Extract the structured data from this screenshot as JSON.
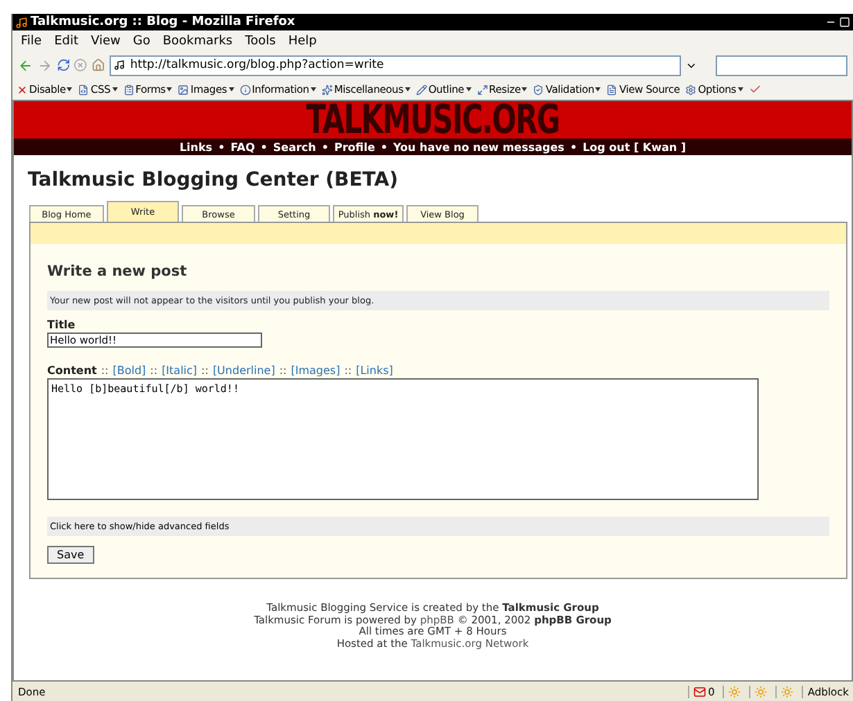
{
  "window": {
    "title": "Talkmusic.org :: Blog - Mozilla Firefox"
  },
  "menu": [
    "File",
    "Edit",
    "View",
    "Go",
    "Bookmarks",
    "Tools",
    "Help"
  ],
  "address": {
    "value": "http://talkmusic.org/blog.php?action=write"
  },
  "toolbar": [
    {
      "label": "Disable",
      "dropdown": true
    },
    {
      "label": "CSS",
      "dropdown": true
    },
    {
      "label": "Forms",
      "dropdown": true
    },
    {
      "label": "Images",
      "dropdown": true
    },
    {
      "label": "Information",
      "dropdown": true
    },
    {
      "label": "Miscellaneous",
      "dropdown": true
    },
    {
      "label": "Outline",
      "dropdown": true
    },
    {
      "label": "Resize",
      "dropdown": true
    },
    {
      "label": "Validation",
      "dropdown": true
    },
    {
      "label": "View Source",
      "dropdown": false
    },
    {
      "label": "Options",
      "dropdown": true
    }
  ],
  "site": {
    "logo": "TALKMUSIC.ORG",
    "separator": "•",
    "nav": [
      "Links",
      "FAQ",
      "Search",
      "Profile",
      "You have no new messages",
      "Log out [ Kwan ]"
    ]
  },
  "page_title": "Talkmusic Blogging Center (BETA)",
  "tabs": [
    {
      "label": "Blog Home",
      "selected": false
    },
    {
      "label": "Write",
      "selected": true
    },
    {
      "label": "Browse",
      "selected": false
    },
    {
      "label": "Setting",
      "selected": false
    },
    {
      "label": "Publish **now!**",
      "selected": false
    },
    {
      "label": "View Blog",
      "selected": false
    }
  ],
  "form": {
    "heading": "Write a new post",
    "notice": "Your new post will not appear to the visitors until you publish your blog.",
    "title_label": "Title",
    "title_value": "Hello world!!",
    "content_label": "Content",
    "separator": "::",
    "format_links": [
      "[Bold]",
      "[Italic]",
      "[Underline]",
      "[Images]",
      "[Links]"
    ],
    "content_value": "Hello [b]beautiful[/b] world!!",
    "advanced": "Click here to show/hide advanced fields",
    "save": "Save"
  },
  "footer": [
    [
      {
        "kind": "plain",
        "text": "Talkmusic Blogging Service is created by the "
      },
      {
        "kind": "bold",
        "text": "Talkmusic Group"
      }
    ],
    [
      {
        "kind": "plain",
        "text": "Talkmusic Forum is powered by "
      },
      {
        "kind": "link",
        "text": "phpBB"
      },
      {
        "kind": "plain",
        "text": " © 2001, 2002 "
      },
      {
        "kind": "bold",
        "text": "phpBB Group"
      }
    ],
    [
      {
        "kind": "plain",
        "text": "All times are GMT + 8 Hours"
      }
    ],
    [
      {
        "kind": "plain",
        "text": "Hosted at the "
      },
      {
        "kind": "link",
        "text": "Talkmusic.org Network"
      }
    ]
  ],
  "status_bar": {
    "text": "Done",
    "mail_count": "0",
    "adblock": "Adblock"
  }
}
